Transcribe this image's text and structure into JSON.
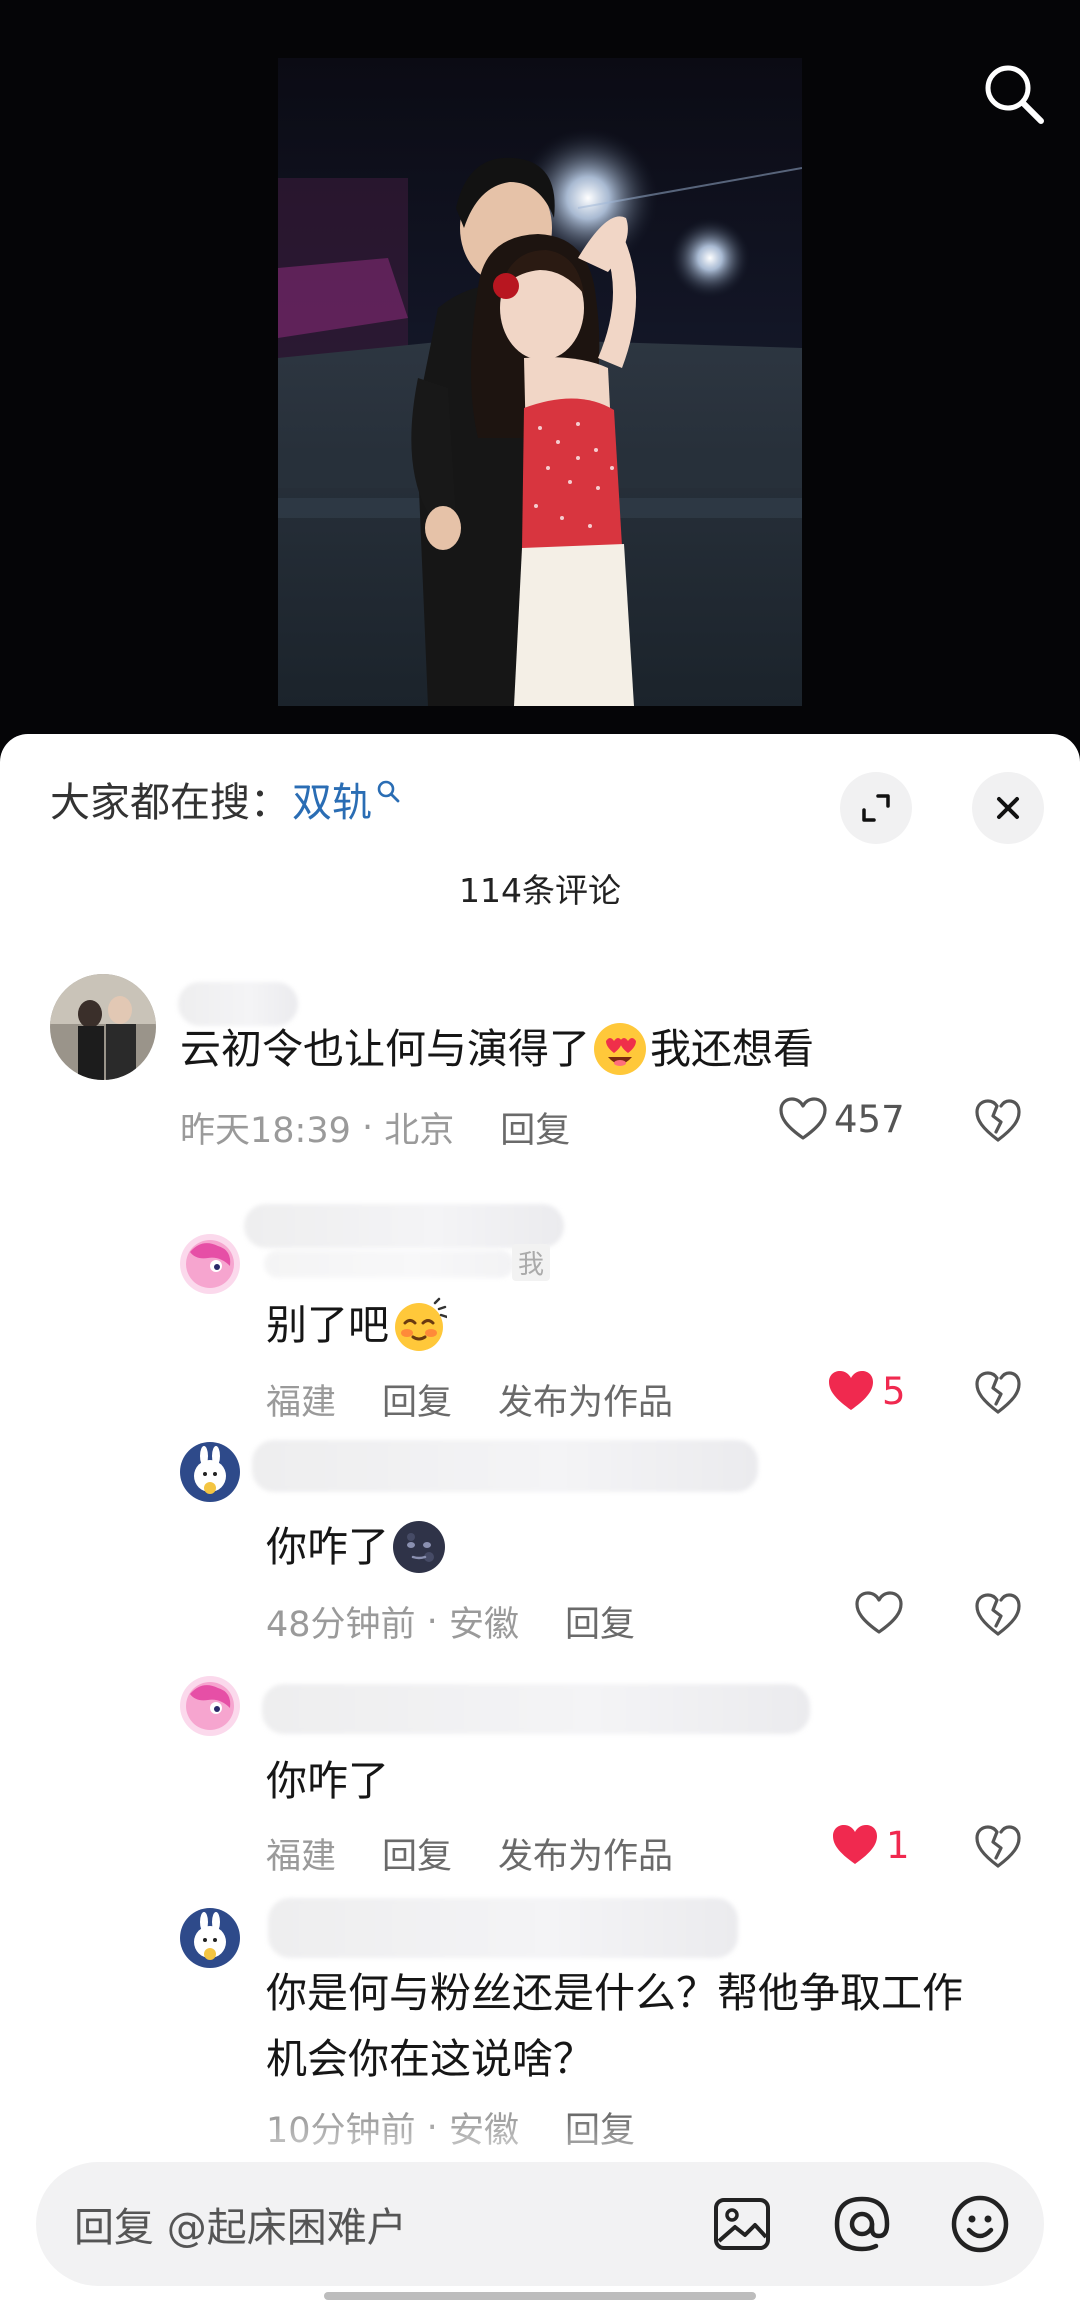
{
  "video": {
    "search_icon": "search-icon"
  },
  "sheet": {
    "hot_search_label": "大家都在搜：",
    "hot_search_keyword": "双轨",
    "comment_count": "114条评论",
    "expand_icon": "expand-icon",
    "close_icon": "close-icon"
  },
  "comments": [
    {
      "text_before": "云初令也让何与演得了",
      "text_after": "我还想看",
      "emoji": "heart-eyes-emoji",
      "time": "昨天18:39",
      "location": "北京",
      "reply_label": "回复",
      "likes": "457",
      "liked": false
    },
    {
      "text_before": "别了吧",
      "text_after": "",
      "emoji": "blushing-sweat-emoji",
      "location": "福建",
      "reply_label": "回复",
      "publish_label": "发布为作品",
      "likes": "5",
      "liked": true,
      "tag": "我"
    },
    {
      "text_before": "你咋了",
      "text_after": "",
      "emoji": "dark-moon-emoji",
      "time": "48分钟前",
      "location": "安徽",
      "reply_label": "回复",
      "likes": "",
      "liked": false
    },
    {
      "text_before": "你咋了",
      "text_after": "",
      "location": "福建",
      "reply_label": "回复",
      "publish_label": "发布为作品",
      "likes": "1",
      "liked": true
    },
    {
      "text_line1": "你是何与粉丝还是什么？帮他争取工作",
      "text_line2": "机会你在这说啥？",
      "time": "10分钟前",
      "location": "安徽",
      "reply_label": "回复",
      "likes": "",
      "liked": false
    }
  ],
  "input": {
    "placeholder": "回复 @起床困难户",
    "icons": [
      "image-icon",
      "at-icon",
      "emoji-icon"
    ]
  },
  "colors": {
    "accent_link": "#2a6db4",
    "like_red": "#f0294f",
    "sheet_bg": "#ffffff",
    "input_bg": "#f2f2f3"
  }
}
